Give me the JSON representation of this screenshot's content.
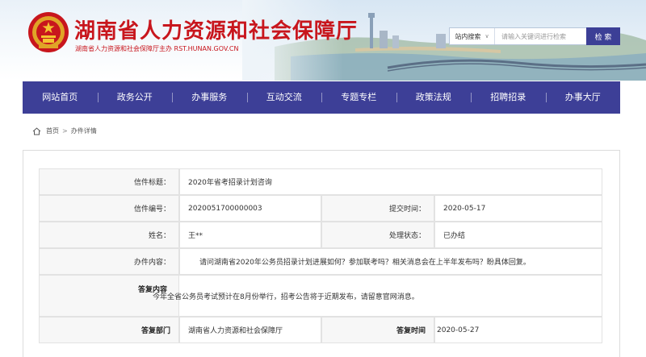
{
  "header": {
    "title": "湖南省人力资源和社会保障厅",
    "subtitle": "湖南省人力资源和社会保障厅主办  RST.HUNAN.GOV.CN",
    "brand_color": "#c8161d"
  },
  "search": {
    "scope": "站内搜索",
    "placeholder": "请输入关键词进行检索",
    "button": "检 索"
  },
  "nav": {
    "color": "#3d3f97",
    "items": [
      "网站首页",
      "政务公开",
      "办事服务",
      "互动交流",
      "专题专栏",
      "政策法规",
      "招聘招录",
      "办事大厅"
    ]
  },
  "breadcrumb": {
    "home": "首页",
    "current": "办件详情"
  },
  "detail": {
    "title_label": "信件标题：",
    "title_value": "2020年省考招录计划咨询",
    "number_label": "信件编号：",
    "number_value": "2020051700000003",
    "submit_label": "提交时间：",
    "submit_value": "2020-05-17",
    "name_label": "姓名：",
    "name_value": "王**",
    "status_label": "处理状态：",
    "status_value": "已办结",
    "content_label": "办件内容：",
    "content_value": "请问湖南省2020年公务员招录计划进展如何？参加联考吗？相关消息会在上半年发布吗？盼具体回复。",
    "reply_label": "答复内容",
    "reply_value": "今年全省公务员考试预计在8月份举行，招考公告将于近期发布，请留意官网消息。",
    "dept_label": "答复部门",
    "dept_value": "湖南省人力资源和社会保障厅",
    "reply_time_label": "答复时间",
    "reply_time_value": "2020-05-27"
  }
}
